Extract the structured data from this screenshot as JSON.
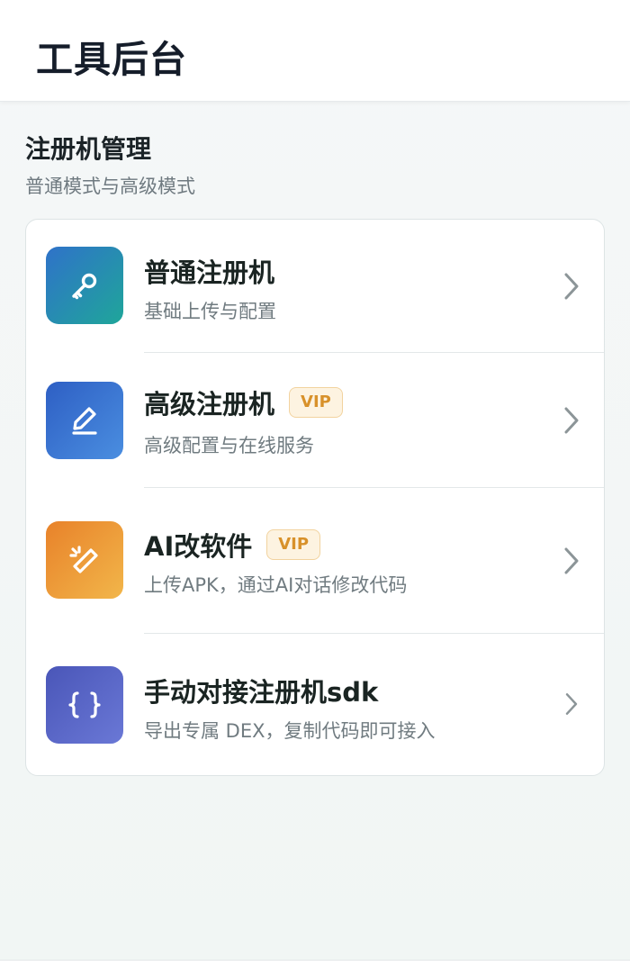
{
  "header": {
    "title": "工具后台"
  },
  "section": {
    "title": "注册机管理",
    "subtitle": "普通模式与高级模式"
  },
  "items": [
    {
      "title": "普通注册机",
      "desc": "基础上传与配置",
      "vip": "",
      "icon": "key-icon",
      "colors": [
        "#2f72c9",
        "#1fa69a"
      ]
    },
    {
      "title": "高级注册机",
      "desc": "高级配置与在线服务",
      "vip": "VIP",
      "icon": "pencil-icon",
      "colors": [
        "#2e5fc4",
        "#4a8ee0"
      ]
    },
    {
      "title": "AI改软件",
      "desc": "上传APK，通过AI对话修改代码",
      "vip": "VIP",
      "icon": "magic-wand-icon",
      "colors": [
        "#e8822a",
        "#f2b64a"
      ]
    },
    {
      "title": "手动对接注册机sdk",
      "desc": "导出专属 DEX，复制代码即可接入",
      "vip": "",
      "icon": "code-braces-icon",
      "colors": [
        "#4a56b8",
        "#6a78d6"
      ]
    }
  ],
  "colors": {
    "accent_vip": "#d8912a",
    "title_text": "#1a2422",
    "muted_text": "#707b80"
  }
}
